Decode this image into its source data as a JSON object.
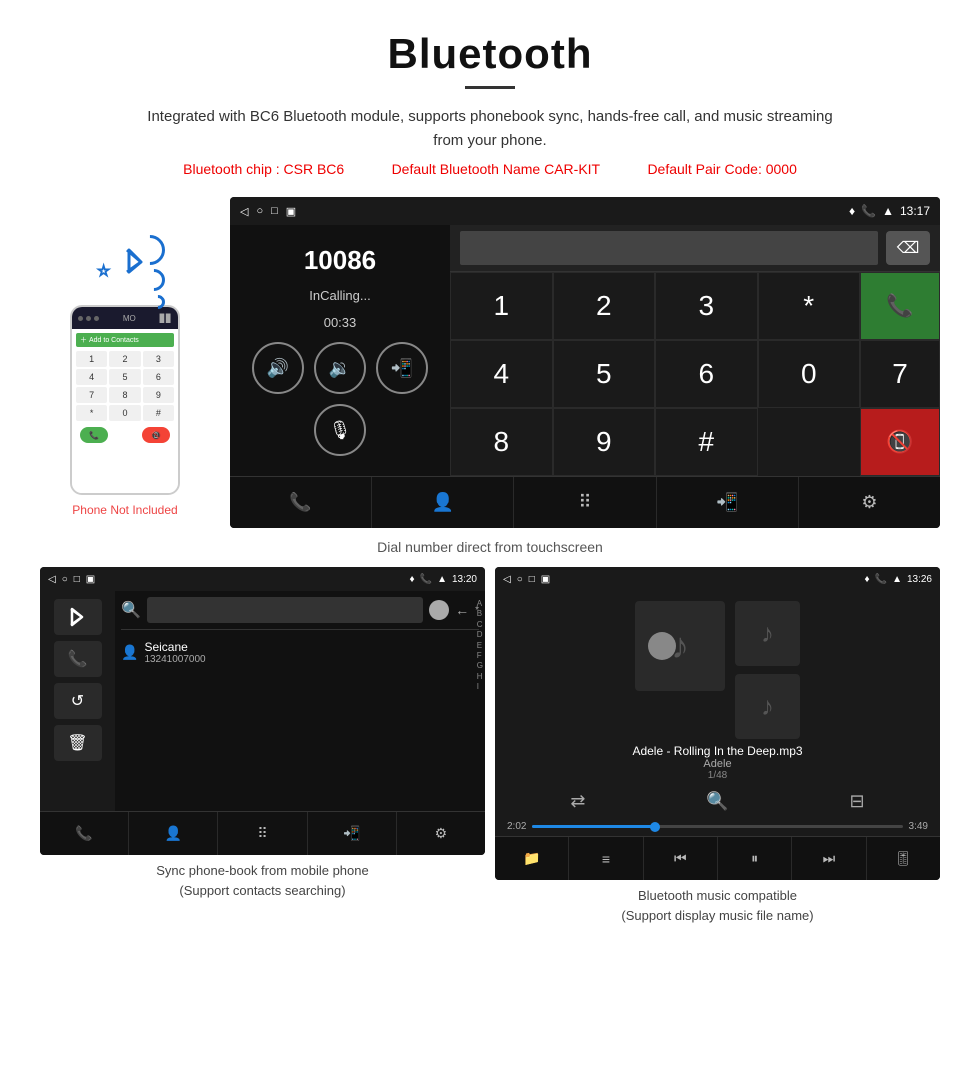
{
  "header": {
    "title": "Bluetooth",
    "description": "Integrated with BC6 Bluetooth module, supports phonebook sync, hands-free call, and music streaming from your phone.",
    "spec_chip": "Bluetooth chip : CSR BC6",
    "spec_name": "Default Bluetooth Name CAR-KIT",
    "spec_code": "Default Pair Code: 0000"
  },
  "dial_screen": {
    "status_time": "13:17",
    "number": "10086",
    "call_status": "InCalling...",
    "timer": "00:33",
    "keys": [
      "1",
      "2",
      "3",
      "*",
      "4",
      "5",
      "6",
      "0",
      "7",
      "8",
      "9",
      "#"
    ],
    "caption": "Dial number direct from touchscreen"
  },
  "phonebook_screen": {
    "status_time": "13:20",
    "contact_name": "Seicane",
    "contact_phone": "13241007000",
    "alpha_list": [
      "A",
      "B",
      "C",
      "D",
      "E",
      "F",
      "G",
      "H",
      "I"
    ],
    "caption_line1": "Sync phone-book from mobile phone",
    "caption_line2": "(Support contacts searching)"
  },
  "music_screen": {
    "status_time": "13:26",
    "song_title": "Adele - Rolling In the Deep.mp3",
    "artist": "Adele",
    "track_count": "1/48",
    "time_current": "2:02",
    "time_total": "3:49",
    "progress_pct": 33,
    "caption_line1": "Bluetooth music compatible",
    "caption_line2": "(Support display music file name)"
  },
  "phone_illustration": {
    "not_included": "Phone Not Included",
    "keys": [
      "1",
      "2",
      "3",
      "4",
      "5",
      "6",
      "7",
      "8",
      "9",
      "*",
      "0",
      "#"
    ]
  }
}
